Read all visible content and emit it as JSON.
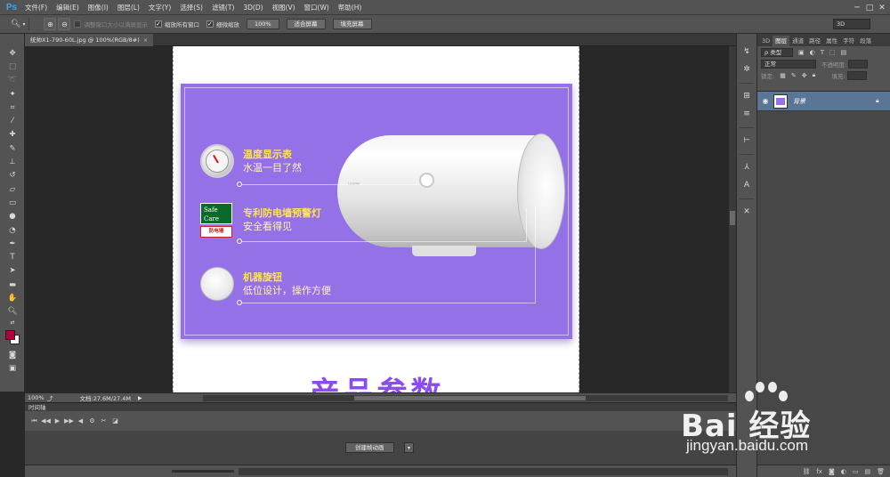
{
  "app": {
    "logo": "Ps"
  },
  "menu": [
    "文件(F)",
    "编辑(E)",
    "图像(I)",
    "图层(L)",
    "文字(Y)",
    "选择(S)",
    "滤镜(T)",
    "3D(D)",
    "视图(V)",
    "窗口(W)",
    "帮助(H)"
  ],
  "window_controls": {
    "minimize": "─",
    "maximize": "□",
    "close": "✕"
  },
  "options": {
    "resize_windows": "调整窗口大小以满屏显示",
    "zoom_all": "缩放所有窗口",
    "scrubby_zoom": "细微缩放",
    "btn_100": "100%",
    "btn_fit": "适合屏幕",
    "btn_fill": "填充屏幕",
    "workspace": "3D"
  },
  "document": {
    "tab_title": "统帅X1-790-60L.jpg @ 100%(RGB/8#)",
    "close": "×"
  },
  "artwork": {
    "features": [
      {
        "title": "温度显示表",
        "subtitle": "水温一目了然"
      },
      {
        "title": "专利防电墙预警灯",
        "subtitle": "安全看得见"
      },
      {
        "title": "机器旋钮",
        "subtitle": "低位设计，操作方便"
      }
    ],
    "safe_care": "Safe Care",
    "brand_strip": "防电墙",
    "heater_logo": "Leader",
    "section_title": "产品参数"
  },
  "status": {
    "zoom": "100%",
    "doc_info": "文档:27.6M/27.4M",
    "arrow": "▶"
  },
  "timeline": {
    "title": "时间轴",
    "create_button": "创建帧动画",
    "dropdown": "▾"
  },
  "layers_panel": {
    "tabs": [
      "3D",
      "图层",
      "通道",
      "路径",
      "属性",
      "字符",
      "段落"
    ],
    "active_tab": "图层",
    "filter_kind": "ρ 类型",
    "blend_mode": "正常",
    "opacity_label": "不透明度:",
    "lock_label": "锁定:",
    "fill_label": "填充:",
    "layer_name": "背景"
  },
  "watermark": {
    "brand": "Bai 经验",
    "url": "jingyan.baidu.com"
  },
  "colors": {
    "foreground": "#b3003a",
    "background": "#ffffff",
    "artwork_purple": "#9571e8",
    "highlight_yellow": "#ffe44a",
    "title_purple": "#8a4cf0",
    "layer_selected": "#5a7696"
  }
}
